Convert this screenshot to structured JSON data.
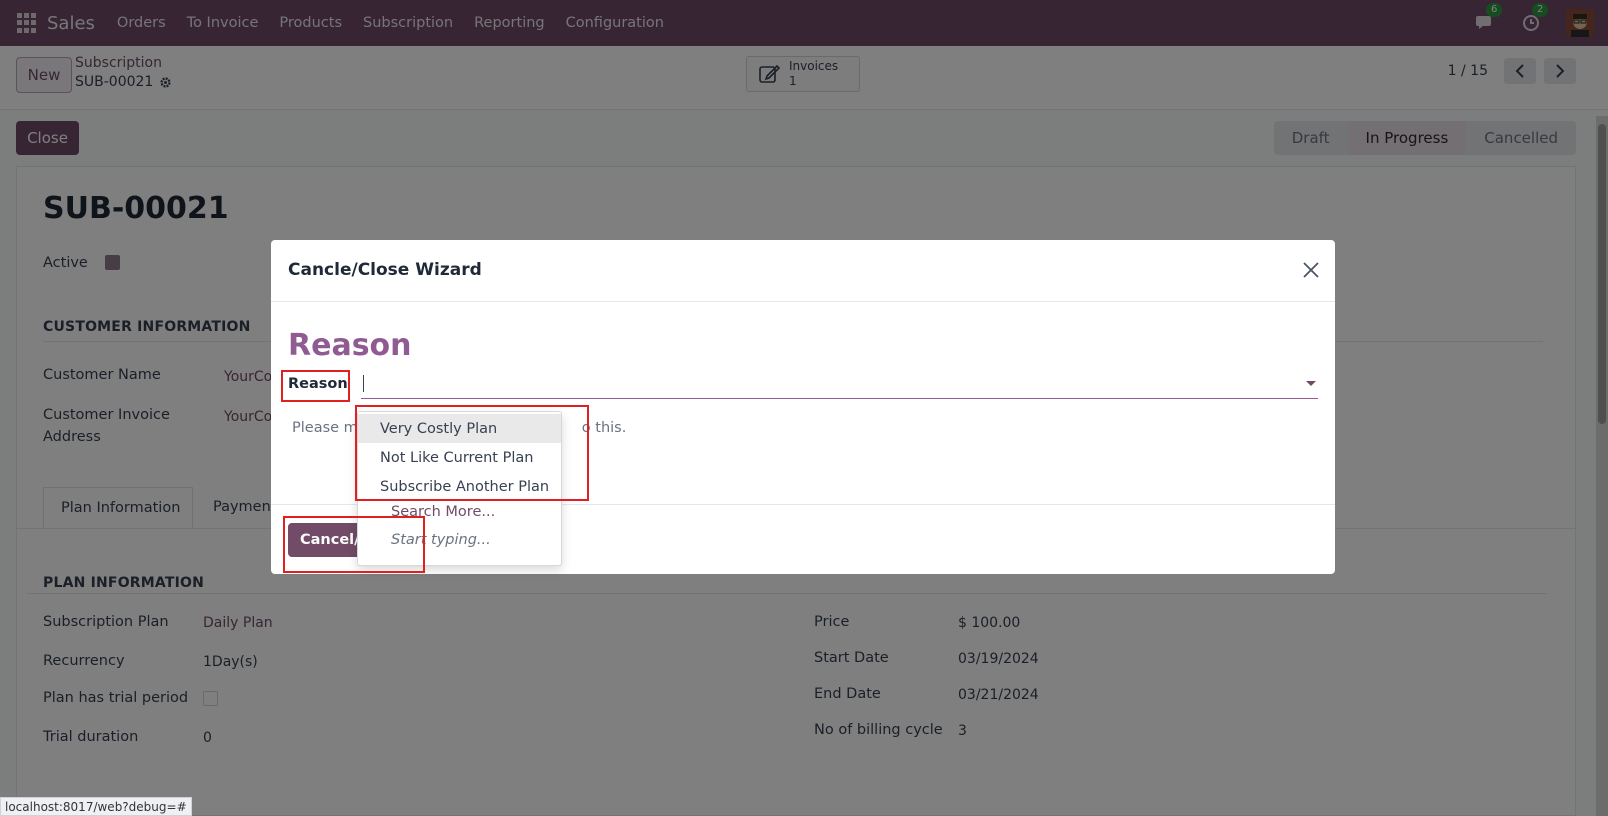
{
  "topbar": {
    "app_name": "Sales",
    "menu": [
      "Orders",
      "To Invoice",
      "Products",
      "Subscription",
      "Reporting",
      "Configuration"
    ],
    "messages_count": "6",
    "activities_count": "2"
  },
  "control": {
    "new_label": "New",
    "breadcrumb_parent": "Subscription",
    "breadcrumb_current": "SUB-00021",
    "stat_button": {
      "label": "Invoices",
      "count": "1"
    },
    "pager": "1 / 15"
  },
  "statusbar": {
    "close_label": "Close",
    "stages": [
      "Draft",
      "In Progress",
      "Cancelled"
    ],
    "active_stage": "In Progress"
  },
  "form": {
    "title": "SUB-00021",
    "active_label": "Active",
    "customer_section": "CUSTOMER INFORMATION",
    "customer_name_label": "Customer Name",
    "customer_name_value": "YourCo",
    "invoice_address_label_1": "Customer Invoice",
    "invoice_address_label_2": "Address",
    "invoice_address_value": "YourCo",
    "tabs": [
      "Plan Information",
      "Payment"
    ],
    "plan_section": "PLAN INFORMATION",
    "left_fields": [
      {
        "label": "Subscription Plan",
        "value": "Daily Plan"
      },
      {
        "label": "Recurrency",
        "value": "1Day(s)"
      },
      {
        "label": "Plan has trial period",
        "value": ""
      },
      {
        "label": "Trial duration",
        "value": "0"
      }
    ],
    "right_fields": [
      {
        "label": "Price",
        "value": "$ 100.00"
      },
      {
        "label": "Start Date",
        "value": "03/19/2024"
      },
      {
        "label": "End Date",
        "value": "03/21/2024"
      },
      {
        "label": "No of billing cycle",
        "value": "3"
      }
    ]
  },
  "modal": {
    "title": "Cancle/Close Wizard",
    "heading": "Reason",
    "reason_label": "Reason",
    "reason_value": "",
    "help_left": "Please m",
    "help_right": "o this.",
    "confirm_label": "Cancel/C"
  },
  "dropdown": {
    "options": [
      "Very Costly Plan",
      "Not Like Current Plan",
      "Subscribe Another Plan"
    ],
    "highlighted": "Very Costly Plan",
    "search_more": "Search More...",
    "hint": "Start typing..."
  },
  "browser_status": "localhost:8017/web?debug=#",
  "colors": {
    "brand": "#714b67",
    "accent": "#8f5b92",
    "highlight": "#e02020"
  }
}
